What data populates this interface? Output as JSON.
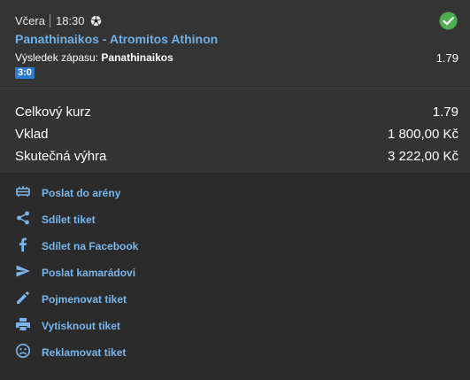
{
  "bet": {
    "day": "Včera",
    "time": "18:30",
    "sport_icon": "soccer-ball-icon",
    "status_icon": "check-circle-icon",
    "status_color": "#4caf50",
    "match": "Panathinaikos - Atromitos Athinon",
    "market_label": "Výsledek zápasu:",
    "market_pick": "Panathinaikos",
    "odds": "1.79",
    "score": "3:0"
  },
  "summary": {
    "total_odds_label": "Celkový kurz",
    "total_odds_value": "1.79",
    "stake_label": "Vklad",
    "stake_value": "1 800,00 Kč",
    "win_label": "Skutečná výhra",
    "win_value": "3 222,00 Kč"
  },
  "actions": [
    {
      "icon": "arena-icon",
      "label": "Poslat do arény"
    },
    {
      "icon": "share-icon",
      "label": "Sdílet tiket"
    },
    {
      "icon": "facebook-icon",
      "label": "Sdílet na Facebook"
    },
    {
      "icon": "send-icon",
      "label": "Poslat kamarádovi"
    },
    {
      "icon": "pencil-icon",
      "label": "Pojmenovat tiket"
    },
    {
      "icon": "printer-icon",
      "label": "Vytisknout tiket"
    },
    {
      "icon": "sad-face-icon",
      "label": "Reklamovat tiket"
    }
  ],
  "colors": {
    "link": "#7ab6ec",
    "match_link": "#6fb0e8",
    "score_badge": "#2d7bd1",
    "background": "#2b2b2b"
  }
}
